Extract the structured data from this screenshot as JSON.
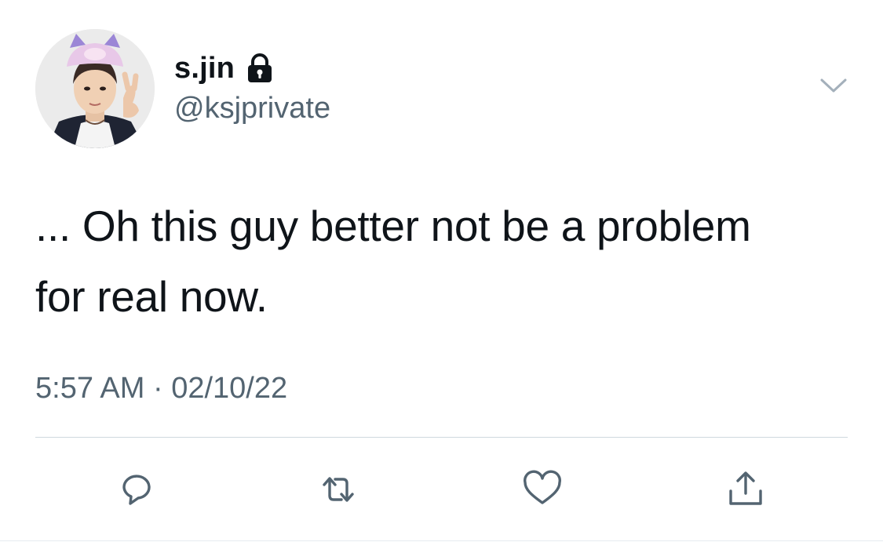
{
  "user": {
    "display_name": "s.jin",
    "handle": "@ksjprivate",
    "protected_icon": "lock-icon",
    "avatar": "avatar"
  },
  "tweet": {
    "text_line1": "... Oh this guy better not be a problem",
    "text_line2": "for real now.",
    "timestamp": "5:57 AM · 02/10/22"
  },
  "actions": {
    "icons": [
      "reply-icon",
      "retweet-icon",
      "like-icon",
      "share-icon"
    ]
  },
  "menu": {
    "icon": "chevron-down-icon"
  },
  "colors": {
    "text": "#0f1419",
    "secondary": "#536471",
    "divider": "#cfd9de",
    "icon": "#536471"
  }
}
